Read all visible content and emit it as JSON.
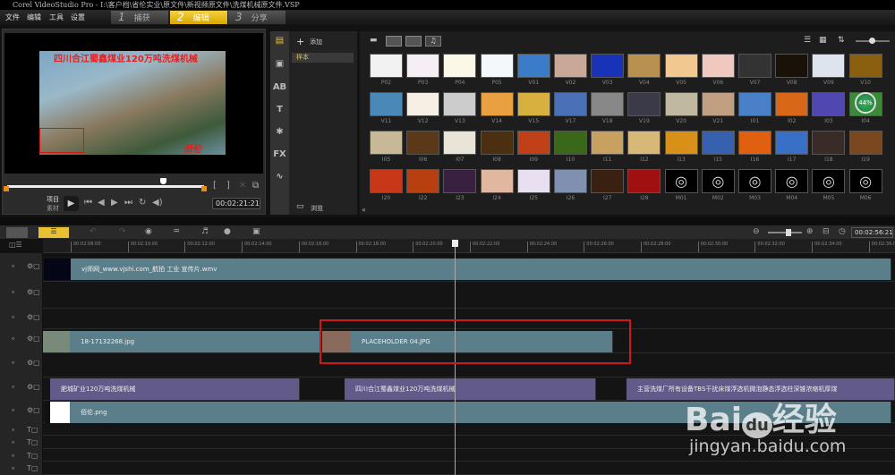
{
  "window": {
    "title": "Corel VideoStudio Pro - I:\\客户档\\省伦实业\\原文件\\新视频原文件\\洗煤机械原文件.VSP"
  },
  "menu": [
    "文件",
    "编辑",
    "工具",
    "设置"
  ],
  "steps": [
    {
      "num": "1",
      "label": "捕获"
    },
    {
      "num": "2",
      "label": "编辑",
      "active": true
    },
    {
      "num": "3",
      "label": "分享"
    }
  ],
  "preview": {
    "caption": "四川合江蜀鑫煤业120万吨洗煤机械",
    "logo": "佰伦",
    "mode_project": "项目",
    "mode_clip": "素材",
    "timecode": "00:02:21:21",
    "playhead_fraction": 0.79
  },
  "library": {
    "add_label": "添加",
    "sample_label": "样本",
    "browse_label": "浏览",
    "progress_badge": "44%",
    "items": [
      {
        "l": "P02",
        "c": "#f2f2f2"
      },
      {
        "l": "P03",
        "c": "#f5eef5"
      },
      {
        "l": "P04",
        "c": "#fbf8e8"
      },
      {
        "l": "P05",
        "c": "#f4f8fb"
      },
      {
        "l": "V01",
        "c": "#3a7cc8"
      },
      {
        "l": "V02",
        "c": "#c9a898"
      },
      {
        "l": "V03",
        "c": "#1833b8"
      },
      {
        "l": "V04",
        "c": "#b89050"
      },
      {
        "l": "V05",
        "c": "#f0c890"
      },
      {
        "l": "V06",
        "c": "#f0c8c0"
      },
      {
        "l": "V07",
        "c": "#333333"
      },
      {
        "l": "V08",
        "c": "#1a1208"
      },
      {
        "l": "V09",
        "c": "#dde4ee"
      },
      {
        "l": "V10",
        "c": "#8a6010"
      },
      {
        "l": "V11",
        "c": "#4a88b8"
      },
      {
        "l": "V12",
        "c": "#f6f0e4"
      },
      {
        "l": "V13",
        "c": "#cccccc"
      },
      {
        "l": "V14",
        "c": "#e8a040"
      },
      {
        "l": "V15",
        "c": "#d8b040"
      },
      {
        "l": "V17",
        "c": "#4a70b8"
      },
      {
        "l": "V18",
        "c": "#888888"
      },
      {
        "l": "V19",
        "c": "#3a3a48"
      },
      {
        "l": "V20",
        "c": "#c0b8a0"
      },
      {
        "l": "V21",
        "c": "#c0a080"
      },
      {
        "l": "I01",
        "c": "#4a80c8"
      },
      {
        "l": "I02",
        "c": "#d86818"
      },
      {
        "l": "I03",
        "c": "#5048b0"
      },
      {
        "l": "I04",
        "c": "#3a8a3a"
      },
      {
        "l": "I05",
        "c": "#c8b898"
      },
      {
        "l": "I06",
        "c": "#5a3818"
      },
      {
        "l": "I07",
        "c": "#e8e4d8"
      },
      {
        "l": "I08",
        "c": "#4a3010"
      },
      {
        "l": "I09",
        "c": "#c04018"
      },
      {
        "l": "I10",
        "c": "#3a6818"
      },
      {
        "l": "I11",
        "c": "#c8a060"
      },
      {
        "l": "I12",
        "c": "#d8b878"
      },
      {
        "l": "I13",
        "c": "#d89018"
      },
      {
        "l": "I15",
        "c": "#3860b0"
      },
      {
        "l": "I16",
        "c": "#e06010"
      },
      {
        "l": "I17",
        "c": "#3870c8"
      },
      {
        "l": "I18",
        "c": "#3a2a28"
      },
      {
        "l": "I19",
        "c": "#7a4820"
      },
      {
        "l": "I20",
        "c": "#c83818"
      },
      {
        "l": "I22",
        "c": "#b84010"
      },
      {
        "l": "I23",
        "c": "#3a2040"
      },
      {
        "l": "I24",
        "c": "#e0b8a0"
      },
      {
        "l": "I25",
        "c": "#e8e0f0"
      },
      {
        "l": "I26",
        "c": "#8090b0"
      },
      {
        "l": "I27",
        "c": "#3a2010"
      },
      {
        "l": "I28",
        "c": "#a01010"
      },
      {
        "l": "M01",
        "c": "#000000"
      },
      {
        "l": "M02",
        "c": "#000000"
      },
      {
        "l": "M03",
        "c": "#000000"
      },
      {
        "l": "M04",
        "c": "#000000"
      },
      {
        "l": "M05",
        "c": "#000000"
      },
      {
        "l": "M06",
        "c": "#000000"
      }
    ]
  },
  "timeline": {
    "total_time": "00:02:56:21",
    "ruler": [
      "00:02:08:00",
      "00:02:10:00",
      "00:02:12:00",
      "00:02:14:00",
      "00:02:16:00",
      "00:02:18:00",
      "00:02:20:00",
      "00:02:22:00",
      "00:02:24:00",
      "00:02:26:00",
      "00:02:28:00",
      "00:02:30:00",
      "00:02:32:00",
      "00:02:34:00",
      "00:02:36:00"
    ],
    "video_clip": "vj师网_www.vjshi.com_航拍 工业 宣传片.wmv",
    "overlay_clips": [
      "18-17132268.jpg",
      "PLACEHOLDER 04.JPG"
    ],
    "title_clips": [
      "肥城矿业120万吨洗煤机械",
      "四川合江蜀鑫煤业120万吨洗煤机械",
      "主营洗煤厂所有设备TBS干扰床煤浮选机微泡静态浮选柱深锥浓缩机厚煤"
    ],
    "logo_clip": "佰伦.png"
  },
  "watermark": {
    "brand": "Bai du 经验",
    "url": "jingyan.baidu.com"
  }
}
